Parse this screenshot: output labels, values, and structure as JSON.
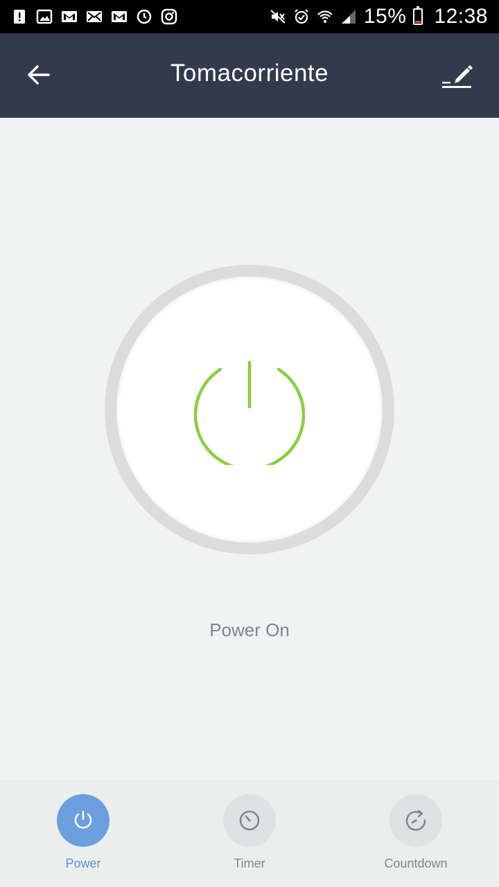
{
  "status_bar": {
    "battery_percent": "15%",
    "time": "12:38",
    "icons_left": [
      "alert-icon",
      "image-icon",
      "gmail-icon",
      "mail-icon",
      "gmail-icon-2",
      "sync-icon",
      "instagram-icon"
    ],
    "icons_right": [
      "mute-icon",
      "alarm-icon",
      "wifi-icon",
      "signal-icon",
      "battery-icon"
    ]
  },
  "app_bar": {
    "title": "Tomacorriente"
  },
  "power": {
    "state_label": "Power On",
    "on": true,
    "accent_color": "#8dcd3c"
  },
  "tabs": [
    {
      "label": "Power",
      "active": true
    },
    {
      "label": "Timer",
      "active": false
    },
    {
      "label": "Countdown",
      "active": false
    }
  ],
  "colors": {
    "app_bar_bg": "#323b4d",
    "active_tab": "#6b9fde",
    "status_text": "#7d8593"
  }
}
